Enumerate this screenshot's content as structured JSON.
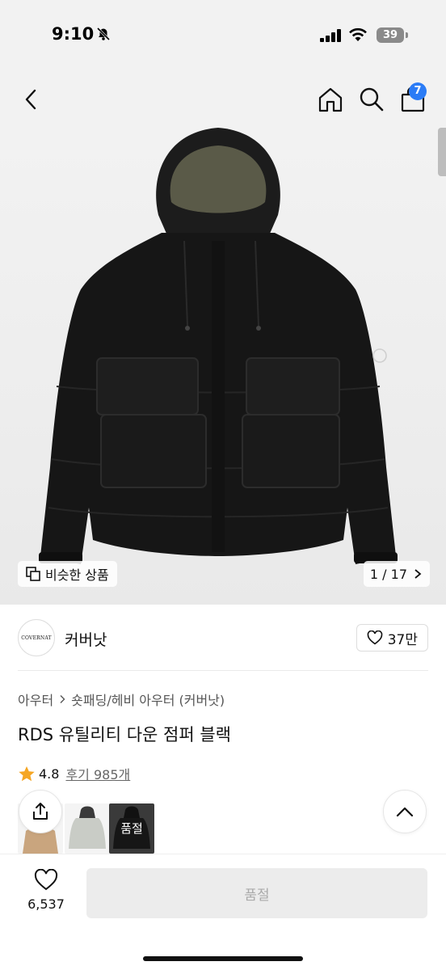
{
  "status_bar": {
    "time": "9:10",
    "battery": "39"
  },
  "header": {
    "cart_count": "7",
    "icons": [
      "chevron-left-icon",
      "home-icon",
      "search-icon",
      "shopping-bag-icon"
    ]
  },
  "hero": {
    "similar_label": "비슷한 상품",
    "image_counter": "1 / 17"
  },
  "brand": {
    "logo_text": "COVERNAT",
    "name": "커버낫",
    "likes": "37만"
  },
  "product": {
    "breadcrumb": [
      "아우터",
      "숏패딩/헤비 아우터 (커버낫)"
    ],
    "title": "RDS 유틸리티 다운 점퍼 블랙",
    "rating": "4.8",
    "reviews": "후기 985개"
  },
  "thumbnails": {
    "sold_out_label": "품절"
  },
  "bottom_bar": {
    "wish_count": "6,537",
    "buy_label": "품절"
  },
  "colors": {
    "accent": "#2b7cf6",
    "star": "#f5a623",
    "disabled_bg": "#ececec"
  }
}
